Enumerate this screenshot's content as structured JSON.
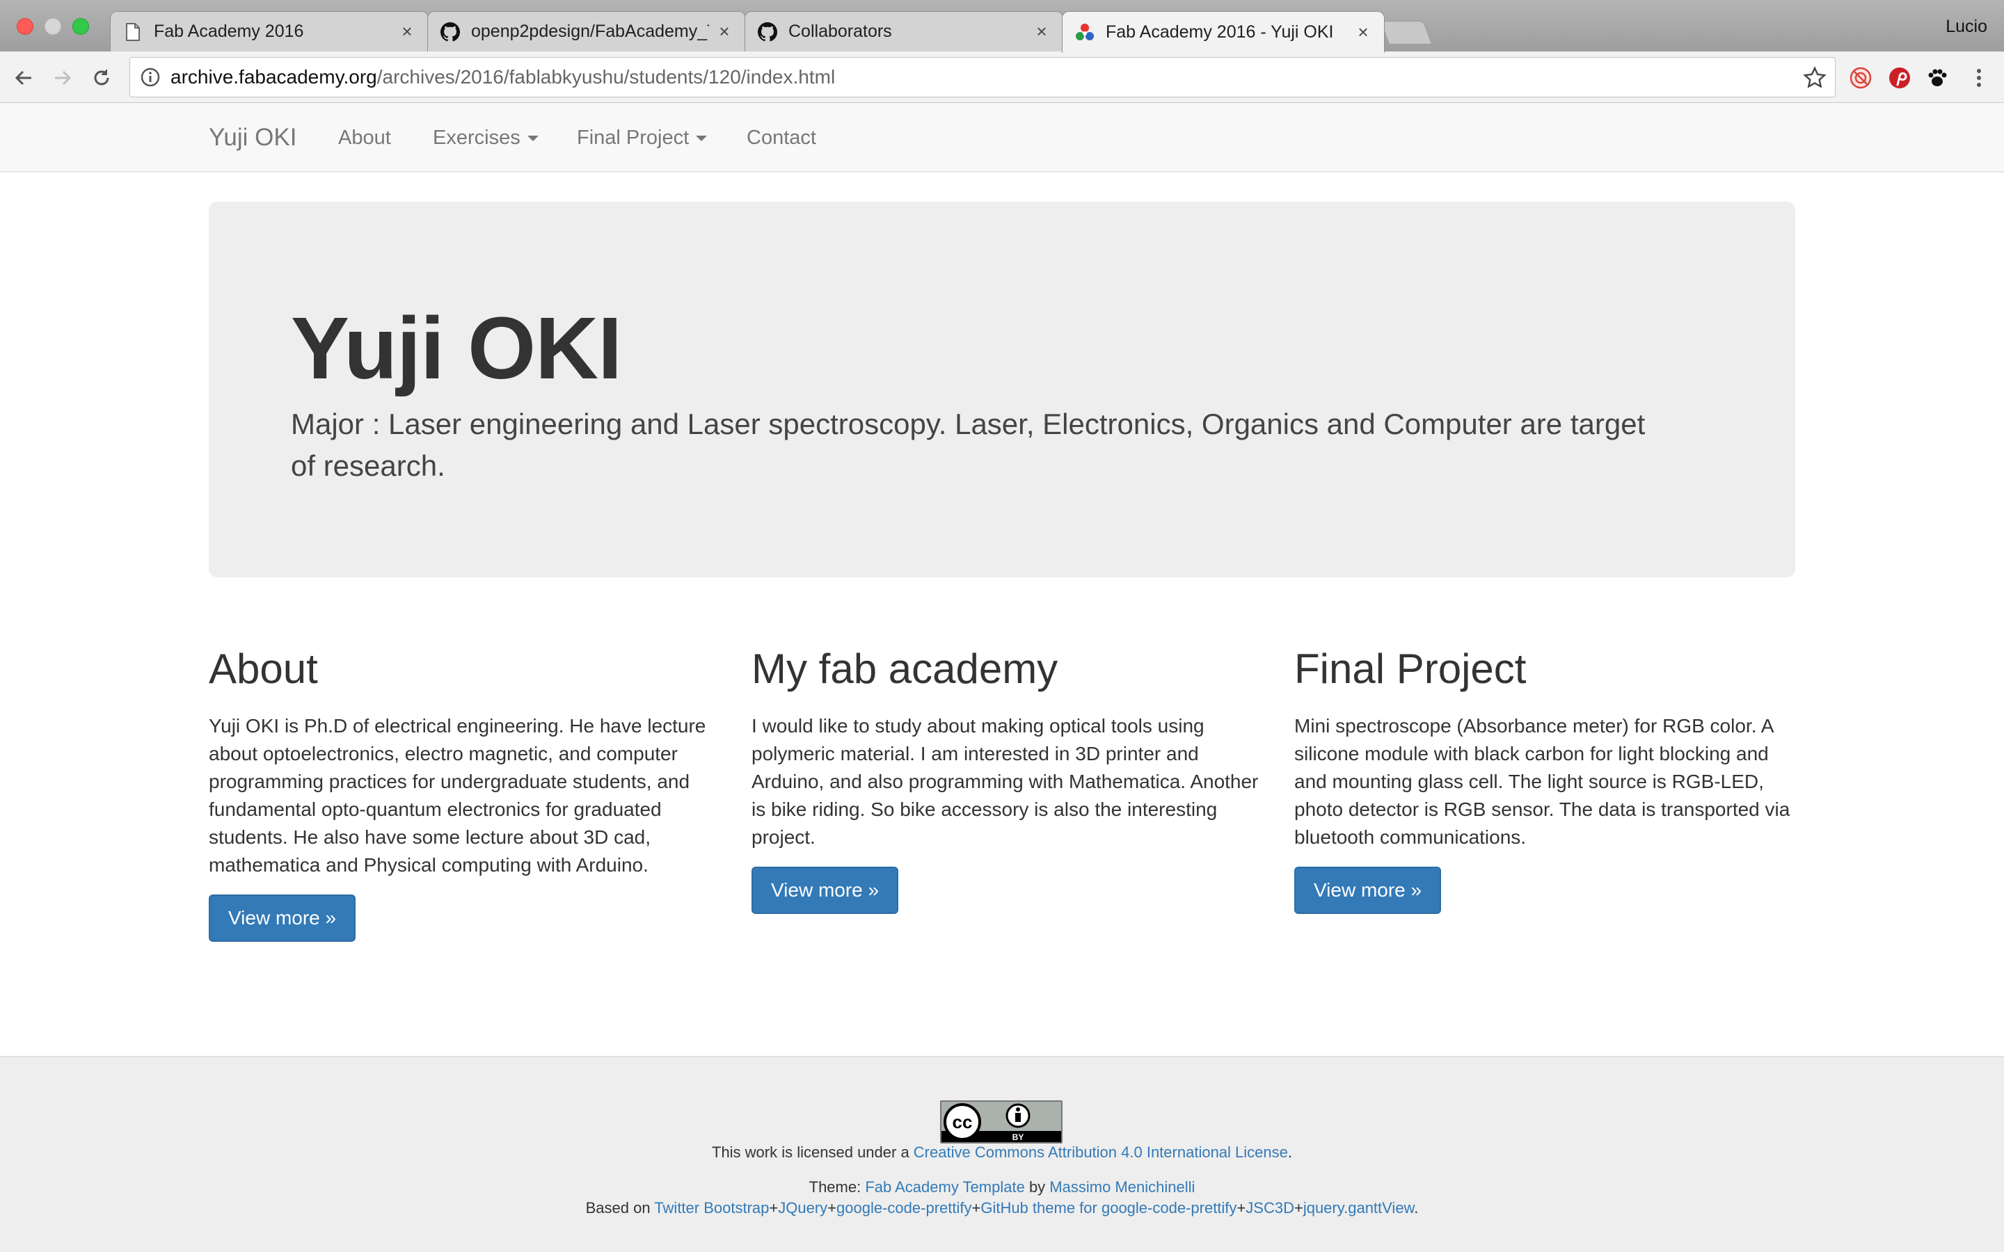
{
  "browser": {
    "tabs": [
      {
        "title": "Fab Academy 2016",
        "icon": "page-icon"
      },
      {
        "title": "openp2pdesign/FabAcademy_T",
        "icon": "github-icon"
      },
      {
        "title": "Collaborators",
        "icon": "github-icon"
      },
      {
        "title": "Fab Academy 2016 - Yuji OKI",
        "icon": "fablab-icon",
        "active": true
      }
    ],
    "profile_name": "Lucio",
    "url_host": "archive.fabacademy.org",
    "url_path": "/archives/2016/fablabkyushu/students/120/index.html"
  },
  "navbar": {
    "brand": "Yuji OKI",
    "items": [
      {
        "label": "About",
        "dropdown": false
      },
      {
        "label": "Exercises",
        "dropdown": true
      },
      {
        "label": "Final Project",
        "dropdown": true
      },
      {
        "label": "Contact",
        "dropdown": false
      }
    ]
  },
  "jumbotron": {
    "title": "Yuji OKI",
    "lead": "Major : Laser engineering and Laser spectroscopy. Laser, Electronics, Organics and Computer are target of research."
  },
  "columns": [
    {
      "heading": "About",
      "text": "Yuji OKI is Ph.D of electrical engineering. He have lecture about optoelectronics, electro magnetic, and computer programming practices for undergraduate students, and fundamental opto-quantum electronics for graduated students. He also have some lecture about 3D cad, mathematica and Physical computing with Arduino.",
      "button": "View more »"
    },
    {
      "heading": "My fab academy",
      "text": "I would like to study about making optical tools using polymeric material. I am interested in 3D printer and Arduino, and also programming with Mathematica. Another is bike riding. So bike accessory is also the interesting project.",
      "button": "View more »"
    },
    {
      "heading": "Final Project",
      "text": "Mini spectroscope (Absorbance meter) for RGB color. A silicone module with black carbon for light blocking and and mounting glass cell. The light source is RGB-LED, photo detector is RGB sensor. The data is transported via bluetooth communications.",
      "button": "View more »"
    }
  ],
  "footer": {
    "badge_text": "BY",
    "license_prefix": "This work is licensed under a ",
    "license_link": "Creative Commons Attribution 4.0 International License",
    "license_suffix": ".",
    "theme_prefix": "Theme: ",
    "theme_link": "Fab Academy Template",
    "theme_by": " by ",
    "theme_author": "Massimo Menichinelli",
    "based_prefix": "Based on ",
    "based_links": [
      "Twitter Bootstrap",
      "JQuery",
      "google-code-prettify",
      "GitHub theme for google-code-prettify",
      "JSC3D",
      "jquery.ganttView"
    ],
    "based_sep": "+",
    "based_suffix": "."
  },
  "colors": {
    "link": "#337ab7",
    "button": "#337ab7",
    "jumbotron_bg": "#eeeeee",
    "navbar_bg": "#f8f8f8"
  }
}
